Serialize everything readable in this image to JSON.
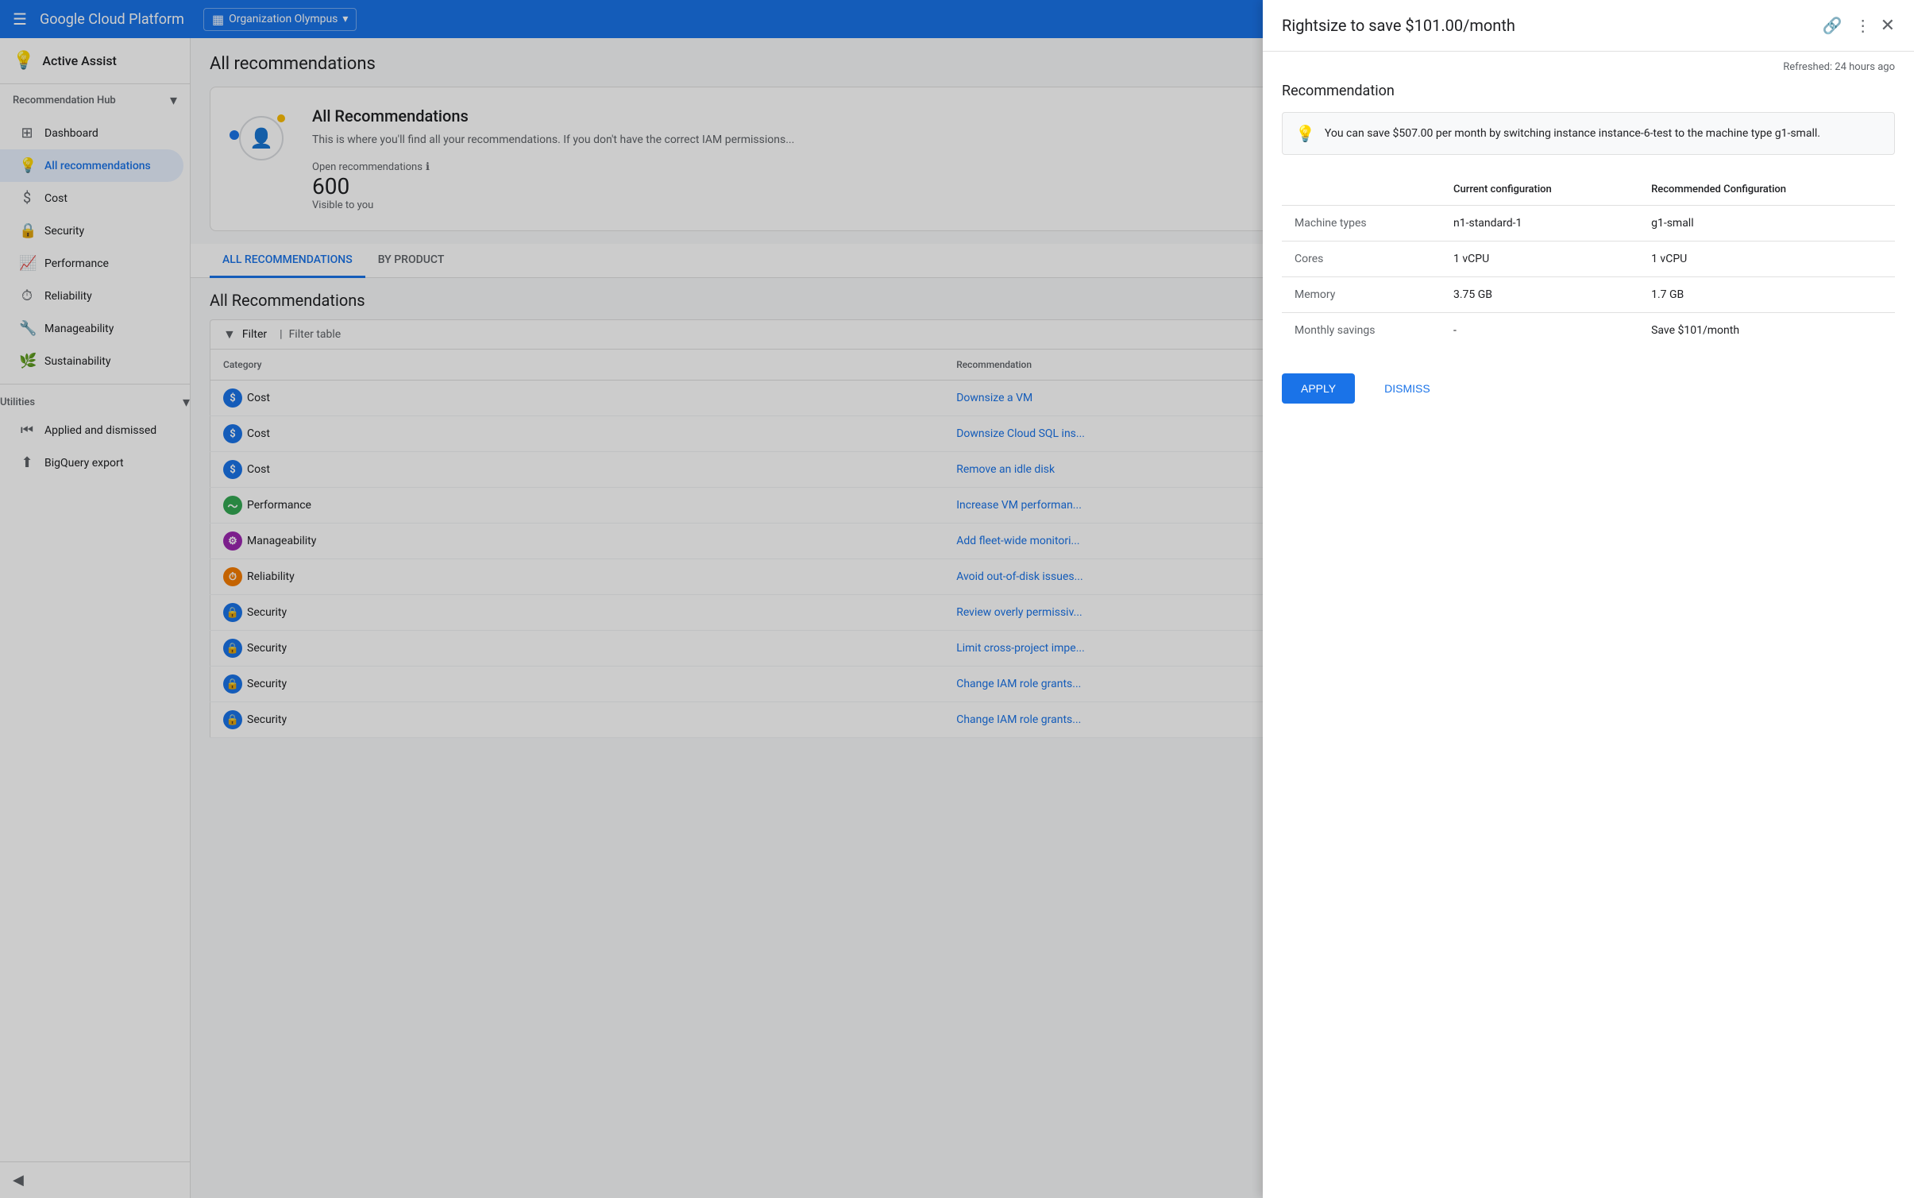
{
  "topNav": {
    "hamburger": "☰",
    "brand": "Google Cloud Platform",
    "org": {
      "icon": "▦",
      "name": "Organization Olympus",
      "chevron": "▾"
    }
  },
  "sidebar": {
    "assistTitle": "Active Assist",
    "recommendationHub": {
      "label": "Recommendation Hub",
      "chevron": "▾"
    },
    "navItems": [
      {
        "id": "dashboard",
        "icon": "⊞",
        "label": "Dashboard",
        "active": false
      },
      {
        "id": "all-recommendations",
        "icon": "💡",
        "label": "All recommendations",
        "active": true
      },
      {
        "id": "cost",
        "icon": "$",
        "label": "Cost",
        "active": false
      },
      {
        "id": "security",
        "icon": "🔒",
        "label": "Security",
        "active": false
      },
      {
        "id": "performance",
        "icon": "📈",
        "label": "Performance",
        "active": false
      },
      {
        "id": "reliability",
        "icon": "⏱",
        "label": "Reliability",
        "active": false
      },
      {
        "id": "manageability",
        "icon": "🔧",
        "label": "Manageability",
        "active": false
      },
      {
        "id": "sustainability",
        "icon": "🌿",
        "label": "Sustainability",
        "active": false
      }
    ],
    "utilities": {
      "label": "Utilities",
      "chevron": "▾",
      "items": [
        {
          "id": "applied-dismissed",
          "icon": "⏮",
          "label": "Applied and dismissed"
        },
        {
          "id": "bigquery-export",
          "icon": "⬆",
          "label": "BigQuery export"
        }
      ]
    },
    "collapseIcon": "◀"
  },
  "content": {
    "pageTitle": "All recommendations",
    "overviewCard": {
      "title": "All Recommendations",
      "description": "This is where you'll find all your recommendations. If you don't have the correct IAM permissions...",
      "openRecs": {
        "label": "Open recommendations",
        "infoIcon": "ℹ",
        "count": "600",
        "visibleLabel": "Visible to you"
      }
    },
    "tabs": [
      {
        "id": "all",
        "label": "ALL RECOMMENDATIONS",
        "active": true
      },
      {
        "id": "by-product",
        "label": "BY PRODUCT",
        "active": false
      }
    ],
    "recsSection": {
      "title": "All Recommendations",
      "filterLabel": "Filter",
      "filterTableLabel": "Filter table",
      "columns": [
        "Category",
        "Recommendation"
      ],
      "rows": [
        {
          "category": "Cost",
          "categoryType": "cost",
          "categoryIcon": "$",
          "recommendation": "Downsize a VM"
        },
        {
          "category": "Cost",
          "categoryType": "cost",
          "categoryIcon": "$",
          "recommendation": "Downsize Cloud SQL ins..."
        },
        {
          "category": "Cost",
          "categoryType": "cost",
          "categoryIcon": "$",
          "recommendation": "Remove an idle disk"
        },
        {
          "category": "Performance",
          "categoryType": "performance",
          "categoryIcon": "~",
          "recommendation": "Increase VM performan..."
        },
        {
          "category": "Manageability",
          "categoryType": "manageability",
          "categoryIcon": "⚙",
          "recommendation": "Add fleet-wide monitori..."
        },
        {
          "category": "Reliability",
          "categoryType": "reliability",
          "categoryIcon": "⏱",
          "recommendation": "Avoid out-of-disk issues..."
        },
        {
          "category": "Security",
          "categoryType": "security",
          "categoryIcon": "🔒",
          "recommendation": "Review overly permissiv..."
        },
        {
          "category": "Security",
          "categoryType": "security",
          "categoryIcon": "🔒",
          "recommendation": "Limit cross-project impe..."
        },
        {
          "category": "Security",
          "categoryType": "security",
          "categoryIcon": "🔒",
          "recommendation": "Change IAM role grants..."
        },
        {
          "category": "Security",
          "categoryType": "security",
          "categoryIcon": "🔒",
          "recommendation": "Change IAM role grants..."
        }
      ]
    }
  },
  "detailPanel": {
    "title": "Rightsize to save $101.00/month",
    "refreshedLabel": "Refreshed: 24 hours ago",
    "sectionTitle": "Recommendation",
    "savingsBanner": "You can save $507.00 per month by switching instance instance-6-test to the machine type g1-small.",
    "configTableHeaders": [
      "",
      "Current configuration",
      "Recommended Configuration"
    ],
    "configRows": [
      {
        "label": "Machine types",
        "current": "n1-standard-1",
        "recommended": "g1-small"
      },
      {
        "label": "Cores",
        "current": "1 vCPU",
        "recommended": "1 vCPU"
      },
      {
        "label": "Memory",
        "current": "3.75 GB",
        "recommended": "1.7 GB"
      },
      {
        "label": "Monthly savings",
        "current": "-",
        "recommended": "Save $101/month"
      }
    ],
    "applyLabel": "APPLY",
    "dismissLabel": "DISMISS"
  }
}
